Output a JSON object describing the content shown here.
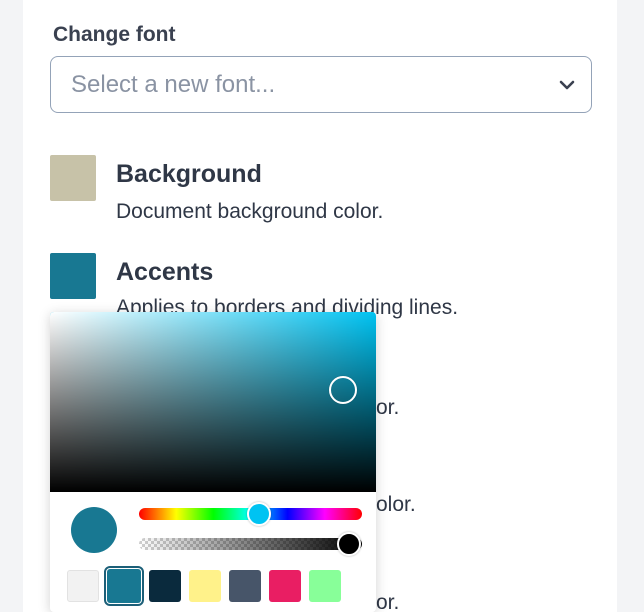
{
  "font": {
    "label": "Change font",
    "placeholder": "Select a new font..."
  },
  "settings": [
    {
      "title": "Background",
      "description": "Document background color.",
      "color": "#c7c2a8"
    },
    {
      "title": "Accents",
      "description": "Applies to borders and dividing lines.",
      "color": "#187892"
    },
    {
      "description": "or."
    },
    {
      "description": "olor."
    },
    {
      "description": "or."
    }
  ],
  "picker": {
    "hue_color": "#00c3f2",
    "current_color": "#187892",
    "presets": [
      "#f2f2f2",
      "#187892",
      "#0a2a3d",
      "#fff28a",
      "#475569",
      "#e91e63",
      "#88ff99"
    ],
    "selected_preset": 1
  }
}
